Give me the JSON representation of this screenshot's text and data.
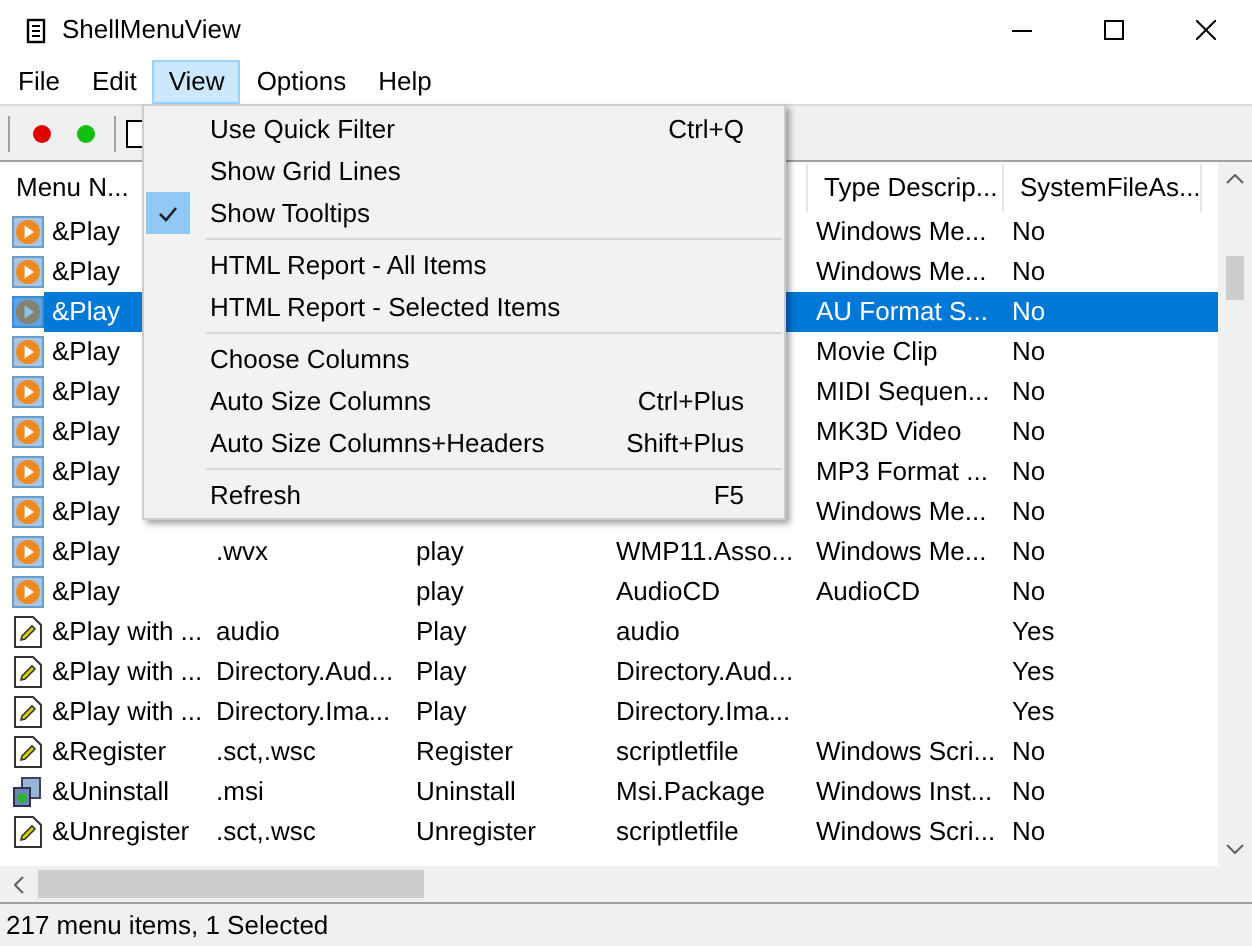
{
  "window": {
    "title": "ShellMenuView"
  },
  "menu_bar": [
    {
      "label": "File",
      "selected": false
    },
    {
      "label": "Edit",
      "selected": false
    },
    {
      "label": "View",
      "selected": true
    },
    {
      "label": "Options",
      "selected": false
    },
    {
      "label": "Help",
      "selected": false
    }
  ],
  "table": {
    "column_headers": {
      "menu_name": "Menu N...",
      "type_description": "Type Descrip...",
      "system_file_association": "SystemFileAs..."
    },
    "rows": [
      {
        "kind": "media",
        "selected": false,
        "cells": {
          "menu_name": "&Play",
          "type_description": "Windows Me...",
          "system_file_association": "No"
        }
      },
      {
        "kind": "media",
        "selected": false,
        "cells": {
          "menu_name": "&Play",
          "type_description": "Windows Me...",
          "system_file_association": "No"
        }
      },
      {
        "kind": "media",
        "selected": true,
        "cells": {
          "menu_name": "&Play",
          "type_description": "AU Format S...",
          "system_file_association": "No"
        }
      },
      {
        "kind": "media",
        "selected": false,
        "cells": {
          "menu_name": "&Play",
          "type_description": "Movie Clip",
          "system_file_association": "No"
        }
      },
      {
        "kind": "media",
        "selected": false,
        "cells": {
          "menu_name": "&Play",
          "type_description": "MIDI Sequen...",
          "system_file_association": "No"
        }
      },
      {
        "kind": "media",
        "selected": false,
        "cells": {
          "menu_name": "&Play",
          "type_description": "MK3D Video",
          "system_file_association": "No"
        }
      },
      {
        "kind": "media",
        "selected": false,
        "cells": {
          "menu_name": "&Play",
          "type_description": "MP3 Format ...",
          "system_file_association": "No"
        }
      },
      {
        "kind": "media",
        "selected": false,
        "cells": {
          "menu_name": "&Play",
          "type_description": "Windows Me...",
          "system_file_association": "No"
        }
      },
      {
        "kind": "media",
        "selected": false,
        "cells": {
          "menu_name": "&Play",
          "column_2": ".wvx",
          "column_3": "play",
          "column_4": "WMP11.Asso...",
          "type_description": "Windows Me...",
          "system_file_association": "No"
        }
      },
      {
        "kind": "media",
        "selected": false,
        "cells": {
          "menu_name": "&Play",
          "column_3": "play",
          "column_4": "AudioCD",
          "type_description": "AudioCD",
          "system_file_association": "No"
        }
      },
      {
        "kind": "script",
        "selected": false,
        "cells": {
          "menu_name": "&Play with ...",
          "column_2": "audio",
          "column_3": "Play",
          "column_4": "audio",
          "system_file_association": "Yes"
        }
      },
      {
        "kind": "script",
        "selected": false,
        "cells": {
          "menu_name": "&Play with ...",
          "column_2": "Directory.Aud...",
          "column_3": "Play",
          "column_4": "Directory.Aud...",
          "system_file_association": "Yes"
        }
      },
      {
        "kind": "script",
        "selected": false,
        "cells": {
          "menu_name": "&Play with ...",
          "column_2": "Directory.Ima...",
          "column_3": "Play",
          "column_4": "Directory.Ima...",
          "system_file_association": "Yes"
        }
      },
      {
        "kind": "script",
        "selected": false,
        "cells": {
          "menu_name": "&Register",
          "column_2": ".sct,.wsc",
          "column_3": "Register",
          "column_4": "scriptletfile",
          "type_description": "Windows Scri...",
          "system_file_association": "No"
        }
      },
      {
        "kind": "installer",
        "selected": false,
        "cells": {
          "menu_name": "&Uninstall",
          "column_2": ".msi",
          "column_3": "Uninstall",
          "column_4": "Msi.Package",
          "type_description": "Windows Inst...",
          "system_file_association": "No"
        }
      },
      {
        "kind": "script",
        "selected": false,
        "cells": {
          "menu_name": "&Unregister",
          "column_2": ".sct,.wsc",
          "column_3": "Unregister",
          "column_4": "scriptletfile",
          "type_description": "Windows Scri...",
          "system_file_association": "No"
        }
      }
    ]
  },
  "view_menu": [
    {
      "kind": "item",
      "label": "Use Quick Filter",
      "shortcut": "Ctrl+Q",
      "checked": false
    },
    {
      "kind": "item",
      "label": "Show Grid Lines",
      "checked": false
    },
    {
      "kind": "item",
      "label": "Show Tooltips",
      "checked": true
    },
    {
      "kind": "separator"
    },
    {
      "kind": "item",
      "label": "HTML Report - All Items",
      "checked": false
    },
    {
      "kind": "item",
      "label": "HTML Report - Selected Items",
      "checked": false
    },
    {
      "kind": "separator"
    },
    {
      "kind": "item",
      "label": "Choose Columns",
      "checked": false
    },
    {
      "kind": "item",
      "label": "Auto Size Columns",
      "shortcut": "Ctrl+Plus",
      "checked": false
    },
    {
      "kind": "item",
      "label": "Auto Size Columns+Headers",
      "shortcut": "Shift+Plus",
      "checked": false
    },
    {
      "kind": "separator"
    },
    {
      "kind": "item",
      "label": "Refresh",
      "shortcut": "F5",
      "checked": false
    }
  ],
  "status_bar": "217 menu items, 1 Selected"
}
